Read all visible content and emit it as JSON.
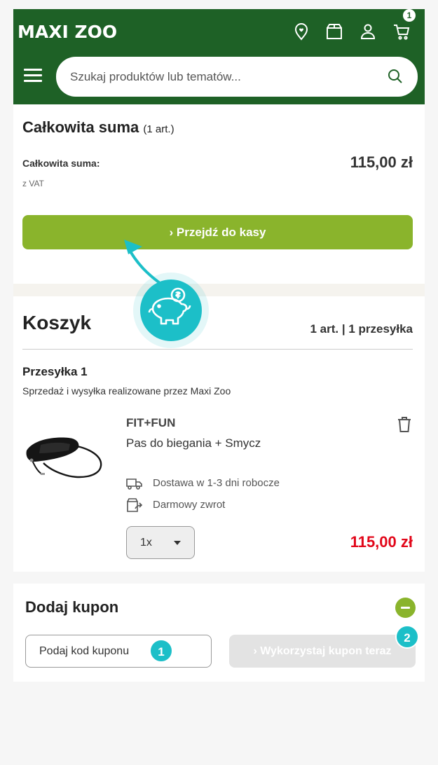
{
  "header": {
    "logo": "MAXI ZOO",
    "cart_count": "1",
    "search_placeholder": "Szukaj produktów lub tematów..."
  },
  "summary": {
    "title": "Całkowita suma",
    "title_count": "(1 art.)",
    "total_label": "Całkowita suma:",
    "total_value": "115,00 zł",
    "vat_note": "z VAT",
    "checkout_label": "› Przejdź do kasy"
  },
  "cart": {
    "title": "Koszyk",
    "meta": "1 art. | 1 przesyłka",
    "shipment_title": "Przesyłka 1",
    "shipment_sub": "Sprzedaż i wysyłka realizowane przez Maxi Zoo",
    "product": {
      "brand": "FIT+FUN",
      "name": "Pas do biegania + Smycz",
      "delivery": "Dostawa w 1-3 dni robocze",
      "returns": "Darmowy zwrot",
      "quantity": "1x",
      "price": "115,00 zł"
    }
  },
  "coupon": {
    "title": "Dodaj kupon",
    "input_placeholder": "Podaj kod kuponu",
    "apply_label": "› Wykorzystaj kupon teraz"
  },
  "tutorial": {
    "badge_1": "1",
    "badge_2": "2"
  },
  "colors": {
    "brand_green": "#1e6126",
    "accent_green": "#8ab42c",
    "price_red": "#e20619",
    "tutorial_teal": "#1cbfc8"
  }
}
